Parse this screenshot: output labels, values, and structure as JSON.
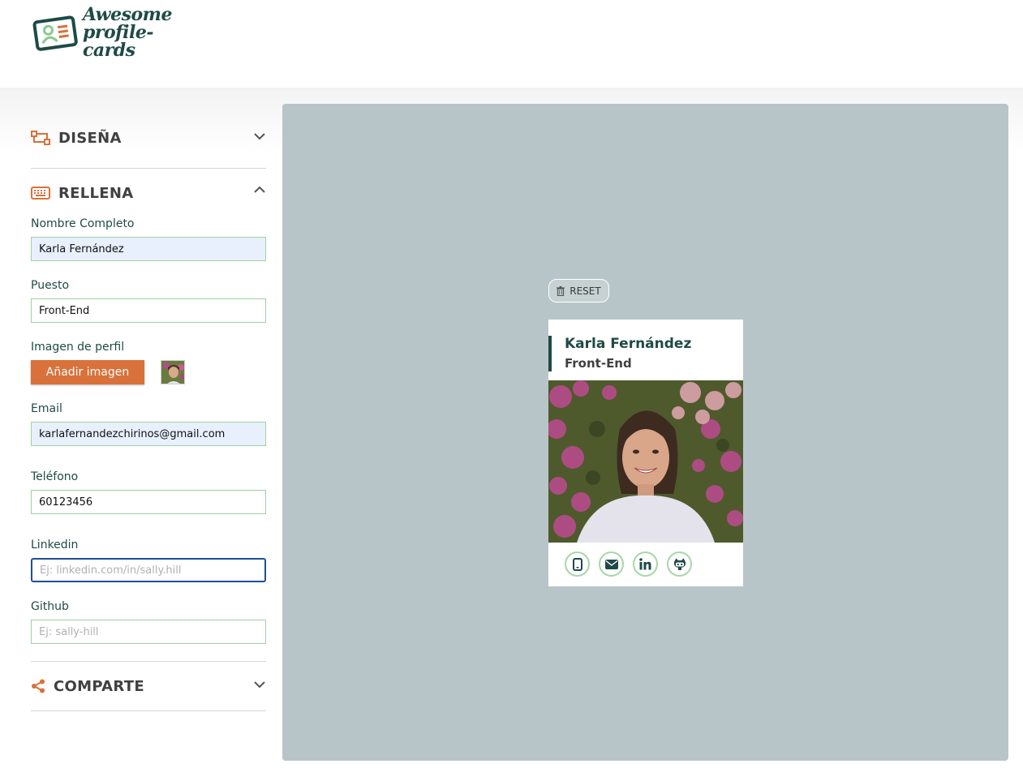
{
  "header": {
    "logo_line1": "Awesome",
    "logo_line2": "profile-cards"
  },
  "sections": {
    "design": {
      "title": "DISEÑA",
      "icon": "design-icon",
      "state": "collapsed"
    },
    "fill": {
      "title": "RELLENA",
      "icon": "keyboard-icon",
      "state": "expanded"
    },
    "share": {
      "title": "COMPARTE",
      "icon": "share-icon",
      "state": "collapsed"
    }
  },
  "form": {
    "name": {
      "label": "Nombre Completo",
      "value": "Karla Fernández",
      "placeholder": ""
    },
    "job": {
      "label": "Puesto",
      "value": "Front-End",
      "placeholder": ""
    },
    "image": {
      "label": "Imagen de perfil",
      "button": "Añadir imagen"
    },
    "email": {
      "label": "Email",
      "value": "karlafernandezchirinos@gmail.com",
      "placeholder": ""
    },
    "phone": {
      "label": "Teléfono",
      "value": "60123456",
      "placeholder": ""
    },
    "linkedin": {
      "label": "Linkedin",
      "value": "",
      "placeholder": "Ej: linkedin.com/in/sally.hill"
    },
    "github": {
      "label": "Github",
      "value": "",
      "placeholder": "Ej: sally-hill"
    }
  },
  "preview": {
    "reset_label": "RESET",
    "card": {
      "name": "Karla Fernández",
      "job": "Front-End",
      "social_icons": [
        "mobile-icon",
        "email-icon",
        "linkedin-icon",
        "github-icon"
      ]
    }
  },
  "colors": {
    "accent": "#d9713a",
    "brand_dark": "#1f4a46",
    "preview_bg": "#b8c5c8",
    "input_border": "#9fd1a0",
    "social_border": "#a6d8a7"
  }
}
